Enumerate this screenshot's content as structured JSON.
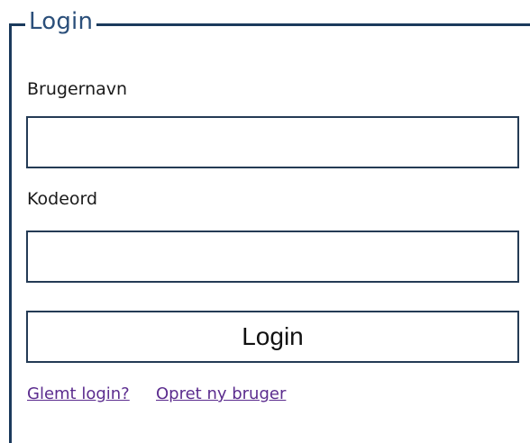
{
  "login_form": {
    "legend": "Login",
    "username": {
      "label": "Brugernavn",
      "value": "",
      "placeholder": ""
    },
    "password": {
      "label": "Kodeord",
      "value": "",
      "placeholder": ""
    },
    "submit_label": "Login",
    "links": {
      "forgot": "Glemt login?",
      "create": "Opret ny bruger"
    }
  },
  "colors": {
    "frame_border": "#1b3a5c",
    "legend_text": "#2b4f7a",
    "input_border": "#243b55",
    "link": "#5b2c8e"
  }
}
